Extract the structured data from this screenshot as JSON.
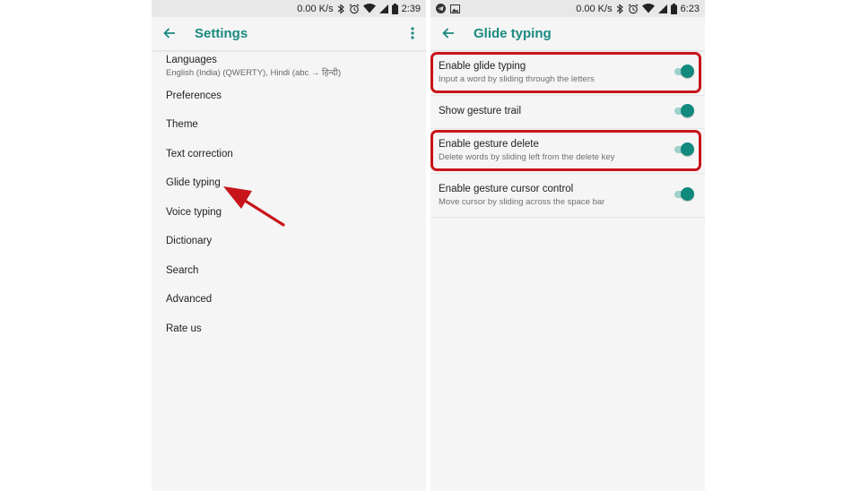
{
  "left_screen": {
    "status": {
      "speed": "0.00 K/s",
      "time": "2:39"
    },
    "title": "Settings",
    "items": [
      {
        "label": "Languages",
        "sub": "English (India) (QWERTY), Hindi (abc → हिन्दी)"
      },
      {
        "label": "Preferences"
      },
      {
        "label": "Theme"
      },
      {
        "label": "Text correction"
      },
      {
        "label": "Glide typing"
      },
      {
        "label": "Voice typing"
      },
      {
        "label": "Dictionary"
      },
      {
        "label": "Search"
      },
      {
        "label": "Advanced"
      },
      {
        "label": "Rate us"
      }
    ]
  },
  "right_screen": {
    "status": {
      "speed": "0.00 K/s",
      "time": "6:23"
    },
    "title": "Glide typing",
    "prefs": [
      {
        "title": "Enable glide typing",
        "sub": "Input a word by sliding through the letters",
        "enabled": true
      },
      {
        "title": "Show gesture trail",
        "enabled": true
      },
      {
        "title": "Enable gesture delete",
        "sub": "Delete words by sliding left from the delete key",
        "enabled": true
      },
      {
        "title": "Enable gesture cursor control",
        "sub": "Move cursor by sliding across the space bar",
        "enabled": true
      }
    ]
  },
  "colors": {
    "accent": "#1a8a80",
    "toggle_thumb": "#11897d",
    "toggle_track": "#9fd2cc",
    "annotation": "#c8151b"
  },
  "icons": {
    "back": "arrow-left-icon",
    "more": "more-vert-icon",
    "status": [
      "bluetooth-icon",
      "alarm-icon",
      "wifi-icon",
      "cell-signal-icon",
      "battery-icon"
    ],
    "notifications": [
      "telegram-icon",
      "image-icon"
    ]
  }
}
